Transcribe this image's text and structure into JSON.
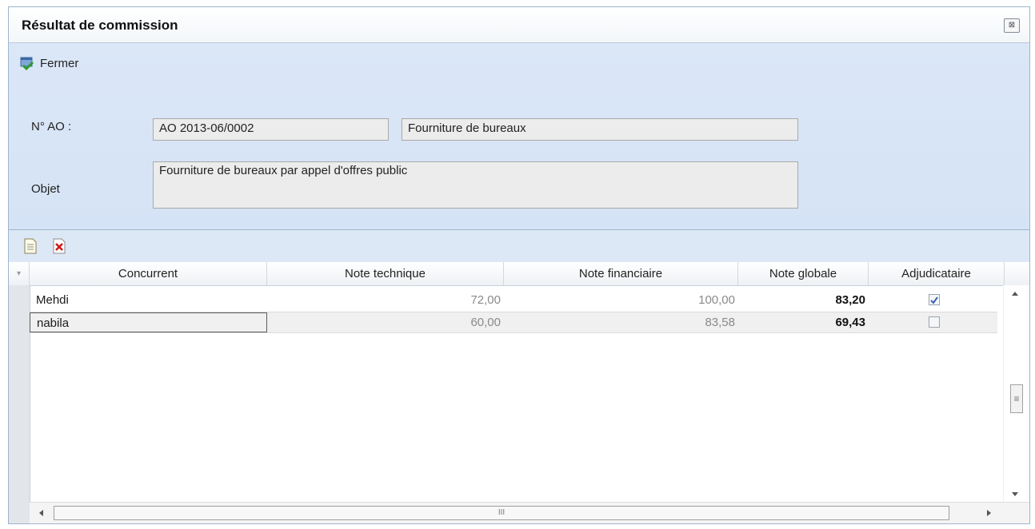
{
  "window": {
    "title": "Résultat de commission",
    "close_glyph": "⊠"
  },
  "toolbar": {
    "fermer_label": "Fermer"
  },
  "form": {
    "ao_label": "N° AO :",
    "ao_number": "AO 2013-06/0002",
    "ao_title": "Fourniture de bureaux",
    "objet_label": "Objet",
    "objet_value": "Fourniture de bureaux par appel d'offres public"
  },
  "grid": {
    "columns": [
      "Concurrent",
      "Note technique",
      "Note financiaire",
      "Note globale",
      "Adjudicataire"
    ],
    "rows": [
      {
        "concurrent": "Mehdi",
        "note_technique": "72,00",
        "note_financiaire": "100,00",
        "note_globale": "83,20",
        "adjudicataire": true
      },
      {
        "concurrent": "nabila",
        "note_technique": "60,00",
        "note_financiaire": "83,58",
        "note_globale": "69,43",
        "adjudicataire": false
      }
    ],
    "hscroll_grip": "III",
    "vscroll_grip": "≡"
  },
  "icons": {
    "fermer": "close-door-icon",
    "add": "new-document-icon",
    "delete": "delete-icon"
  },
  "colors": {
    "panel_bg": "#dce8f7",
    "border": "#9fb4cc",
    "check": "#3a5fb0"
  }
}
